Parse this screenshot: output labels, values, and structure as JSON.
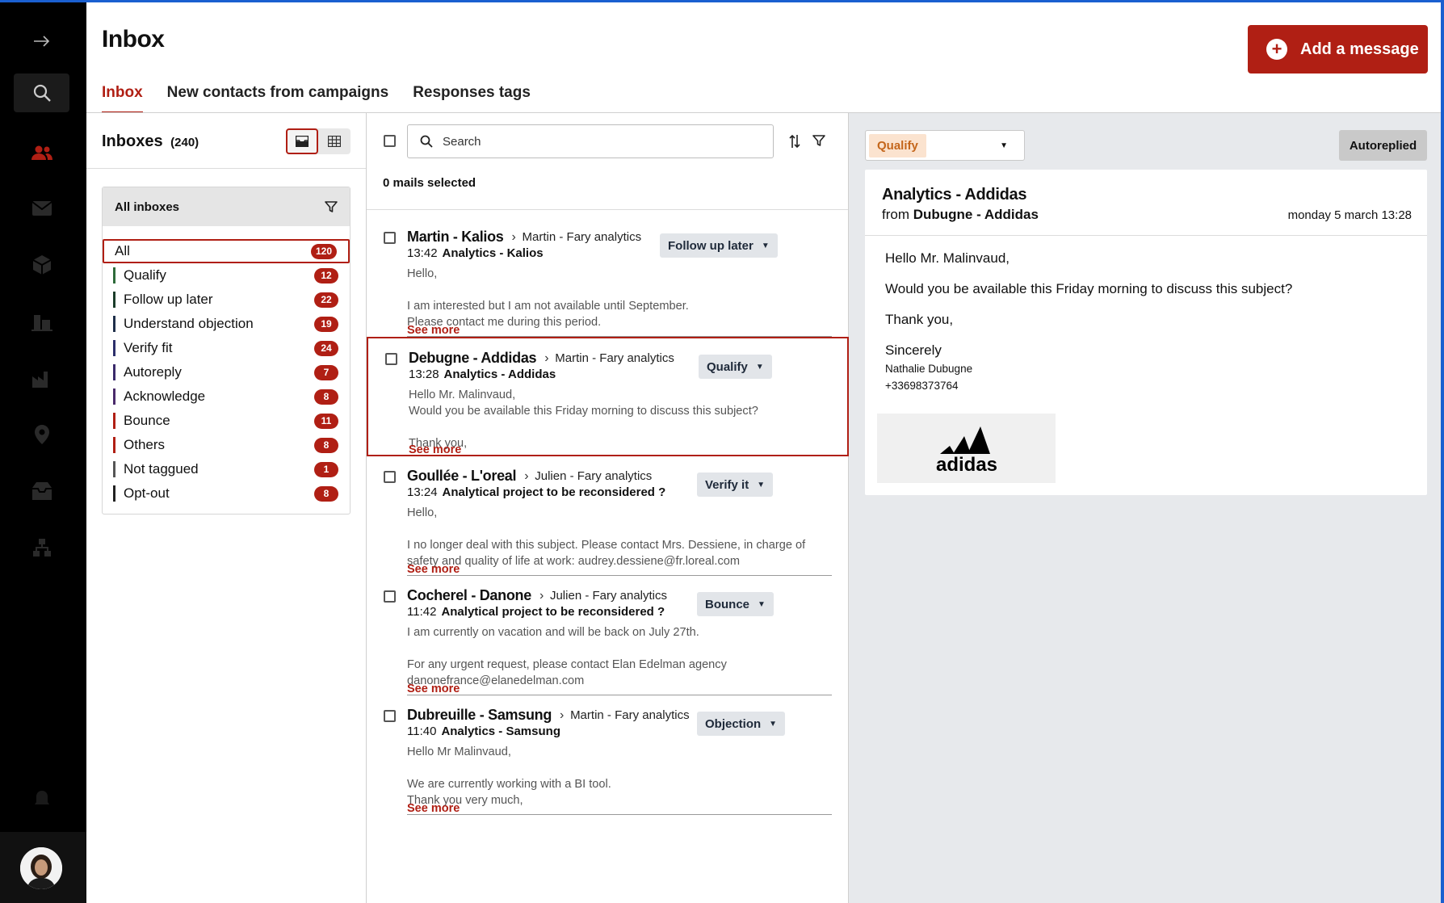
{
  "header": {
    "title": "Inbox",
    "add_button": "Add a message",
    "tabs": [
      {
        "label": "Inbox"
      },
      {
        "label": "New contacts from campaigns"
      },
      {
        "label": "Responses tags"
      }
    ]
  },
  "inboxes": {
    "title": "Inboxes",
    "count": "(240)",
    "filter_header": "All inboxes",
    "items": [
      {
        "label": "All",
        "count": "120",
        "color": ""
      },
      {
        "label": "Qualify",
        "count": "12",
        "color": "#2e6b3a"
      },
      {
        "label": "Follow up later",
        "count": "22",
        "color": "#1b3d2a"
      },
      {
        "label": "Understand objection",
        "count": "19",
        "color": "#1f2f4a"
      },
      {
        "label": "Verify fit",
        "count": "24",
        "color": "#2c2f6b"
      },
      {
        "label": "Autoreply",
        "count": "7",
        "color": "#3a2a6b"
      },
      {
        "label": "Acknowledge",
        "count": "8",
        "color": "#4a2a6b"
      },
      {
        "label": "Bounce",
        "count": "11",
        "color": "#b01f14"
      },
      {
        "label": "Others",
        "count": "8",
        "color": "#b01f14"
      },
      {
        "label": "Not taggued",
        "count": "1",
        "color": "#555555"
      },
      {
        "label": "Opt-out",
        "count": "8",
        "color": "#222222"
      }
    ]
  },
  "mail_list": {
    "search_placeholder": "Search",
    "selected": "0 mails selected",
    "see_more": "See more",
    "mails": [
      {
        "from": "Martin - Kalios",
        "via": "Martin - Fary analytics",
        "time": "13:42",
        "subject": "Analytics - Kalios",
        "tag": "Follow up later",
        "body": [
          "Hello,",
          "",
          "I am interested but I am not available until September.",
          "Please contact me during this period."
        ]
      },
      {
        "from": "Debugne - Addidas",
        "via": "Martin - Fary analytics",
        "time": "13:28",
        "subject": "Analytics - Addidas",
        "tag": "Qualify",
        "body": [
          "Hello Mr. Malinvaud,",
          "Would you be available this Friday morning to discuss this subject?",
          "",
          "Thank you,"
        ]
      },
      {
        "from": "Goullée - L'oreal",
        "via": "Julien - Fary analytics",
        "time": "13:24",
        "subject": "Analytical project to be reconsidered ?",
        "tag": "Verify it",
        "body": [
          "Hello,",
          "",
          "I no longer deal with this subject. Please contact Mrs. Dessiene, in charge of",
          "safety and quality of life at work: audrey.dessiene@fr.loreal.com"
        ]
      },
      {
        "from": "Cocherel - Danone",
        "via": "Julien - Fary analytics",
        "time": "11:42",
        "subject": "Analytical project to be reconsidered ?",
        "tag": "Bounce",
        "body": [
          "I am currently on vacation and will be back on July 27th.",
          "",
          "For any urgent request, please contact Elan Edelman agency",
          "danonefrance@elanedelman.com"
        ]
      },
      {
        "from": "Dubreuille - Samsung",
        "via": "Martin - Fary analytics",
        "time": "11:40",
        "subject": "Analytics - Samsung",
        "tag": "Objection",
        "body": [
          "Hello Mr Malinvaud,",
          "",
          "We are currently working with a BI tool.",
          "Thank you very much,"
        ]
      }
    ]
  },
  "detail": {
    "tag": "Qualify",
    "status": "Autoreplied",
    "subject": "Analytics - Addidas",
    "from_prefix": "from",
    "from_name": "Dubugne - Addidas",
    "date": "monday 5 march 13:28",
    "lines": [
      "Hello Mr. Malinvaud,",
      "Would you be available this Friday morning to discuss this subject?",
      "Thank you,"
    ],
    "closing": "Sincerely",
    "signature_name": "Nathalie Dubugne",
    "signature_phone": "+33698373764",
    "logo_text": "adidas"
  }
}
